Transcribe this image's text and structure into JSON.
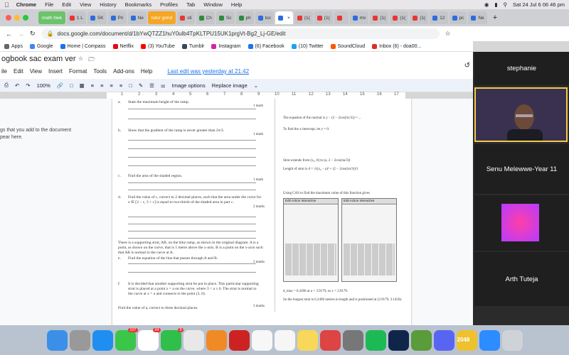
{
  "menubar": {
    "app": "Chrome",
    "items": [
      "File",
      "Edit",
      "View",
      "History",
      "Bookmarks",
      "Profiles",
      "Tab",
      "Window",
      "Help"
    ],
    "datetime": "Sat 24 Jul 6 06 46 pm"
  },
  "tabs": [
    {
      "label": "math hwk",
      "group": true,
      "color": "#6cc36c"
    },
    {
      "label": "1 L",
      "color": "#e33"
    },
    {
      "label": "SK",
      "color": "#2a6de0"
    },
    {
      "label": "Pri",
      "color": "#2a6de0"
    },
    {
      "label": "Ne",
      "color": "#2a6de0"
    },
    {
      "label": "tutor grind",
      "group": true,
      "color": "#f5a623"
    },
    {
      "label": "sti",
      "color": "#e33"
    },
    {
      "label": "Ch",
      "color": "#2c8d3c"
    },
    {
      "label": "Sc",
      "color": "#2c8d3c"
    },
    {
      "label": "ph",
      "color": "#2c8d3c"
    },
    {
      "label": "loc",
      "color": "#2a6de0"
    },
    {
      "label": "",
      "active": true,
      "color": "#2a6de0"
    },
    {
      "label": "(1(",
      "color": "#e33"
    },
    {
      "label": "(1(",
      "color": "#e33"
    },
    {
      "label": "",
      "color": "#e33"
    },
    {
      "label": "mv",
      "color": "#2a6de0"
    },
    {
      "label": "(1(",
      "color": "#e33"
    },
    {
      "label": "(1(",
      "color": "#e33"
    },
    {
      "label": "(1(",
      "color": "#e33"
    },
    {
      "label": "12",
      "color": "#2a6de0"
    },
    {
      "label": "pc",
      "color": "#2a6de0"
    },
    {
      "label": "Ne",
      "color": "#2a6de0"
    }
  ],
  "url": "docs.google.com/document/d/1bYwQTZZ1huY0ulb4TpKLTPU15UK1prgVt-Bg2_Lj-GE/edit",
  "bookmarks": [
    {
      "label": "Apps",
      "color": "#666"
    },
    {
      "label": "Google",
      "color": "#4285f4"
    },
    {
      "label": "Home | Compass",
      "color": "#1a73e8"
    },
    {
      "label": "Netflix",
      "color": "#e50914"
    },
    {
      "label": "(3) YouTube",
      "color": "#ff0000"
    },
    {
      "label": "Tumblr",
      "color": "#36465d"
    },
    {
      "label": "Instagram",
      "color": "#d6249f"
    },
    {
      "label": "(6) Facebook",
      "color": "#1877f2"
    },
    {
      "label": "(10) Twitter",
      "color": "#1da1f2"
    },
    {
      "label": "SoundCloud",
      "color": "#ff5500"
    },
    {
      "label": "Inbox (6) - doa00...",
      "color": "#d93025"
    }
  ],
  "doc": {
    "title": "ogbook sac exam ver",
    "menu": [
      "ile",
      "Edit",
      "View",
      "Insert",
      "Format",
      "Tools",
      "Add-ons",
      "Help"
    ],
    "last_edit": "Last edit was yesterday at 21:42",
    "zoom": "100%",
    "image_options": "Image options",
    "replace_image": "Replace image",
    "outline_text": "gs that you add to the document\npear here.",
    "ruler_ticks": [
      "1",
      "2",
      "3",
      "4",
      "5",
      "6",
      "7",
      "8",
      "9",
      "10",
      "11",
      "12",
      "13",
      "14",
      "15",
      "16",
      "17"
    ]
  },
  "page": {
    "questions": [
      {
        "label": "a.",
        "text": "State the maximum height of the ramp.",
        "marks": "1 mark"
      },
      {
        "label": "b.",
        "text": "Show that the gradient of the ramp is never greater than 2π/3.",
        "marks": "1 mark"
      },
      {
        "label": "c.",
        "text": "Find the area of the shaded region.",
        "marks": "1 mark"
      },
      {
        "label": "d.",
        "text": "Find the value of c, correct to 2 decimal places, such that the area under the curve for x ∈ [3 − c, 3 + c] is equal to two-thirds of the shaded area in part c.",
        "marks": "2 marks"
      },
      {
        "label": "e.",
        "text": "Find the equation of the line that passes through A and B.",
        "marks": "2 marks"
      },
      {
        "label": "f.",
        "text": "It is decided that another supporting strut be put in place. This particular supporting strut is placed at a point x = a on the curve, where 3 < a ≤ 6. The strut is normal to the curve at x = a and connects to the point (3, 0).",
        "marks": "3 marks"
      }
    ],
    "support_text": "There is a supporting strut, AB, on the bike ramp, as shown in the original diagram. A is a point, as shown on the curve, that is 1 metre above the x-axis. B is a point on the x-axis such that AB is normal to the curve at A.",
    "find_a_text": "Find the value of a, correct to three decimal places.",
    "right_lines": [
      "The equation of the normal is y − (2 − 2cos(πx/3)) = ...",
      "To find the x-intercept, let y = 0.",
      "Strut extends from (x₀, 0) to (a, 2 − 2cos(πa/3))",
      "Length of strut is d = √((x₀ − a)² + (2 − 2cos(πa/3))²)",
      "Using CAS to find the maximum value of this function gives"
    ],
    "calc_header": "Edit Action Interactive",
    "conclusion": "d_max = 6.2496 at a = 3.9179, so x = 3.9179.",
    "final": "So the longest strut is 6.2496 metres in length and is positioned at (3.9179, 3.1450)."
  },
  "participants": [
    {
      "name": "stephanie"
    },
    {
      "name": "Senu Melewwe-Year 11"
    },
    {
      "name": "Arth Tuteja"
    }
  ],
  "dock": [
    {
      "name": "finder-icon",
      "color": "#3b8fe8"
    },
    {
      "name": "launchpad-icon",
      "color": "#999"
    },
    {
      "name": "safari-icon",
      "color": "#1f8ef1"
    },
    {
      "name": "messages-icon",
      "color": "#3ac649",
      "badge": "107"
    },
    {
      "name": "calendar-icon",
      "color": "#ffffff",
      "badge": "24"
    },
    {
      "name": "facetime-icon",
      "color": "#2fbf4a",
      "badge": "8"
    },
    {
      "name": "chrome-icon",
      "color": "#e8e8e8"
    },
    {
      "name": "vlc-icon",
      "color": "#f08a24"
    },
    {
      "name": "photobooth-icon",
      "color": "#c22"
    },
    {
      "name": "photos-icon",
      "color": "#f7f7f7"
    },
    {
      "name": "notes-icon",
      "color": "#f6f6f6"
    },
    {
      "name": "stickies-icon",
      "color": "#f7d85a"
    },
    {
      "name": "pdf-icon",
      "color": "#d44"
    },
    {
      "name": "settings-icon",
      "color": "#777"
    },
    {
      "name": "spotify-icon",
      "color": "#1db954"
    },
    {
      "name": "steam-icon",
      "color": "#10254a"
    },
    {
      "name": "minecraft-icon",
      "color": "#5a9b3a"
    },
    {
      "name": "discord-icon",
      "color": "#5865f2"
    },
    {
      "name": "2048-icon",
      "color": "#edc22e",
      "label": "2048"
    },
    {
      "name": "zoom-icon",
      "color": "#2d8cff"
    },
    {
      "name": "trash-icon",
      "color": "#cfd3d8"
    }
  ]
}
